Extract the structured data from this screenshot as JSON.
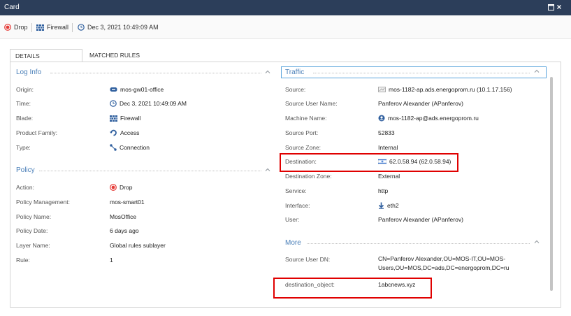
{
  "window": {
    "title": "Card"
  },
  "summary": {
    "action": "Drop",
    "blade": "Firewall",
    "datetime": "Dec 3, 2021 10:49:09 AM"
  },
  "tabs": [
    {
      "label": "DETAILS",
      "active": true
    },
    {
      "label": "MATCHED RULES",
      "active": false
    }
  ],
  "log_info": {
    "title": "Log Info",
    "rows": [
      {
        "label": "Origin:",
        "value": "mos-gw01-office",
        "icon": "gateway-icon"
      },
      {
        "label": "Time:",
        "value": "Dec 3, 2021 10:49:09 AM",
        "icon": "clock-icon"
      },
      {
        "label": "Blade:",
        "value": "Firewall",
        "icon": "firewall-icon"
      },
      {
        "label": "Product Family:",
        "value": "Access",
        "icon": "access-icon"
      },
      {
        "label": "Type:",
        "value": "Connection",
        "icon": "connection-icon"
      }
    ]
  },
  "policy": {
    "title": "Policy",
    "rows": [
      {
        "label": "Action:",
        "value": "Drop",
        "icon": "drop-icon"
      },
      {
        "label": "Policy Management:",
        "value": "mos-smart01"
      },
      {
        "label": "Policy Name:",
        "value": "MosOffice"
      },
      {
        "label": "Policy Date:",
        "value": "6 days ago"
      },
      {
        "label": "Layer Name:",
        "value": "Global rules sublayer"
      },
      {
        "label": "Rule:",
        "value": "1"
      }
    ]
  },
  "traffic": {
    "title": "Traffic",
    "rows": [
      {
        "label": "Source:",
        "value": "mos-1182-ap.ads.energoprom.ru (10.1.17.156)",
        "icon": "host-icon"
      },
      {
        "label": "Source User Name:",
        "value": "Panferov Alexander (APanferov)"
      },
      {
        "label": "Machine Name:",
        "value": "mos-1182-ap@ads.energoprom.ru",
        "icon": "machine-icon"
      },
      {
        "label": "Source Port:",
        "value": "52833"
      },
      {
        "label": "Source Zone:",
        "value": "Internal"
      },
      {
        "label": "Destination:",
        "value": "62.0.58.94 (62.0.58.94)",
        "icon": "flag-icon"
      },
      {
        "label": "Destination Zone:",
        "value": "External"
      },
      {
        "label": "Service:",
        "value": "http"
      },
      {
        "label": "Interface:",
        "value": "eth2",
        "icon": "download-arrow-icon"
      },
      {
        "label": "User:",
        "value": "Panferov Alexander (APanferov)"
      }
    ]
  },
  "more": {
    "title": "More",
    "rows": [
      {
        "label": "Source User DN:",
        "value": "CN=Panferov Alexander,OU=MOS-IT,OU=MOS-Users,OU=MOS,DC=ads,DC=energoprom,DC=ru"
      },
      {
        "label": "destination_object:",
        "value": "1abcnews.xyz"
      }
    ]
  },
  "colors": {
    "titlebar": "#2c3e5a",
    "section_title": "#4a7fb8",
    "highlight": "#e00000",
    "drop_red": "#e53935",
    "icon_blue": "#2f5f9e"
  }
}
